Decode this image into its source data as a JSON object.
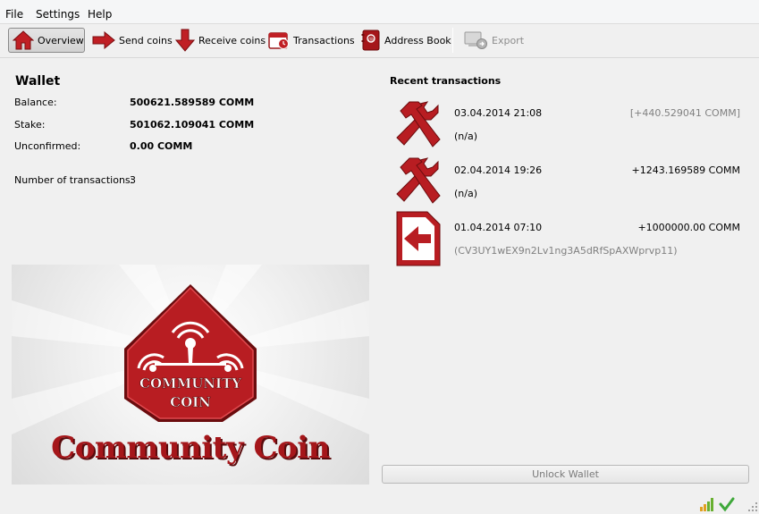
{
  "menu": {
    "file": "File",
    "settings": "Settings",
    "help": "Help"
  },
  "toolbar": {
    "overview": "Overview",
    "send": "Send coins",
    "receive": "Receive coins",
    "transactions": "Transactions",
    "address_book": "Address Book",
    "export": "Export"
  },
  "wallet": {
    "title": "Wallet",
    "balance_label": "Balance:",
    "balance_value": "500621.589589 COMM",
    "stake_label": "Stake:",
    "stake_value": "501062.109041 COMM",
    "unconfirmed_label": "Unconfirmed:",
    "unconfirmed_value": "0.00 COMM",
    "num_tx_label": "Number of transactions:",
    "num_tx_value": "3"
  },
  "logo": {
    "badge_line1": "COMMUNITY",
    "badge_line2": "COIN",
    "brand_name": "Community Coin",
    "brand_color": "#a5161a"
  },
  "recent": {
    "title": "Recent transactions",
    "items": [
      {
        "type": "mined",
        "date": "03.04.2014 21:08",
        "amount": "[+440.529041 COMM]",
        "confirmed": false,
        "detail": "(n/a)"
      },
      {
        "type": "mined",
        "date": "02.04.2014 19:26",
        "amount": "+1243.169589 COMM",
        "confirmed": true,
        "detail": "(n/a)"
      },
      {
        "type": "received",
        "date": "01.04.2014 07:10",
        "amount": "+1000000.00 COMM",
        "confirmed": true,
        "detail": "(CV3UY1wEX9n2Lv1ng3A5dRfSpAXWprvp11)"
      }
    ]
  },
  "unlock_button": "Unlock Wallet",
  "status": {
    "signal_icon": "connections-signal-icon",
    "sync_icon": "synced-check-icon"
  }
}
